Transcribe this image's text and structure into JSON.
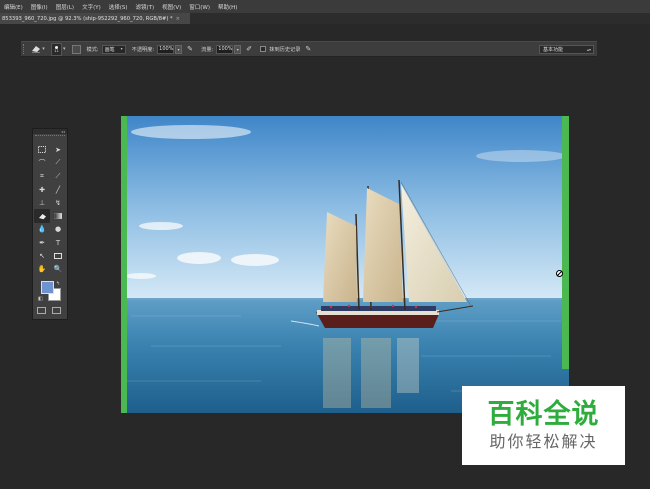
{
  "menubar": {
    "items": [
      "编辑(E)",
      "图像(I)",
      "图层(L)",
      "文字(Y)",
      "选择(S)",
      "滤镜(T)",
      "视图(V)",
      "窗口(W)",
      "帮助(H)"
    ]
  },
  "document_tab": {
    "title": "853393_960_720.jpg @ 92.3% (ship-952292_960_720, RGB/8#) *",
    "close_glyph": "×"
  },
  "options_bar": {
    "brush_size": "11",
    "mode_label": "模式:",
    "mode_value": "画笔",
    "opacity_label": "不透明度:",
    "opacity_value": "100%",
    "flow_label": "流量:",
    "flow_value": "100%",
    "history_label": "抹到历史记录",
    "workspace_value": "基本功能"
  },
  "toolbox": {
    "collapse_glyph": "◂◂",
    "active_tool": "eraser",
    "foreground_color": "#6e93cf",
    "background_color": "#ffffff"
  },
  "document": {
    "subject": "sailing ship on calm blue sea under sky"
  },
  "watermark": {
    "title": "百科全说",
    "subtitle": "助你轻松解决"
  },
  "colors": {
    "accent_green": "#4cb851",
    "watermark_green": "#2fad3c"
  }
}
